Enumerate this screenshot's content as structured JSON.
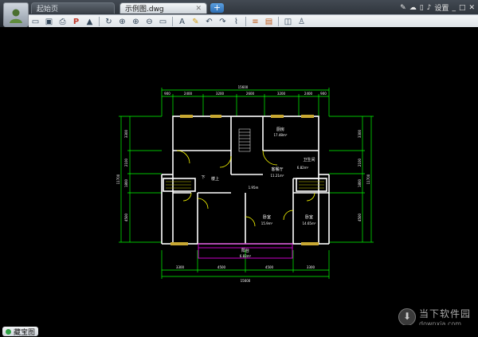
{
  "tabs": [
    {
      "label": "起始页",
      "active": false
    },
    {
      "label": "示例图.dwg",
      "active": true
    }
  ],
  "new_tab_label": "+",
  "top_right": {
    "settings_label": "设置"
  },
  "toolbar": {
    "icons": [
      "open-icon",
      "save-icon",
      "print-icon",
      "pdf-icon",
      "lock-icon",
      "rotate-icon",
      "zoom-extents-icon",
      "zoom-in-icon",
      "zoom-out-icon",
      "pan-icon",
      "text-icon",
      "pencil-icon",
      "undo-icon",
      "redo-icon",
      "link-icon",
      "layer-icon",
      "hatch-icon",
      "layers-icon",
      "user-icon"
    ]
  },
  "drawing": {
    "top_total": "15600",
    "top_dims": [
      "900",
      "2400",
      "3200",
      "2600",
      "3200",
      "2400",
      "900"
    ],
    "bottom_dims": [
      "3300",
      "4500",
      "4500",
      "3300"
    ],
    "bottom_total": "15600",
    "left_dims": [
      "3300",
      "2100",
      "1800",
      "4500"
    ],
    "left_total": "11700",
    "right_dims": [
      "3300",
      "2100",
      "1800",
      "4500"
    ],
    "right_total": "11700",
    "rooms": [
      {
        "name": "厨房",
        "area": "17.48m²"
      },
      {
        "name": "客餐厅",
        "area": "11.21m²"
      },
      {
        "name": "卫生间",
        "area": "6.82m²"
      },
      {
        "name": "卧室",
        "area": "15.9m²"
      },
      {
        "name": "卧室",
        "area": "14.65m²"
      },
      {
        "name": "阳台",
        "area": "6.83m²"
      },
      {
        "name": "楼上",
        "area": ""
      },
      {
        "name": "下",
        "area": ""
      }
    ],
    "small_note": "1.95m"
  },
  "status": {
    "button_label": "藏宝图"
  },
  "watermark": {
    "title": "当下软件园",
    "url": "downxia.com"
  },
  "colors": {
    "wall": "#ffffff",
    "door": "#ffff00",
    "dim": "#00ff00",
    "window": "#c8a832",
    "balcony": "#c800c8",
    "canvas": "#000000"
  }
}
